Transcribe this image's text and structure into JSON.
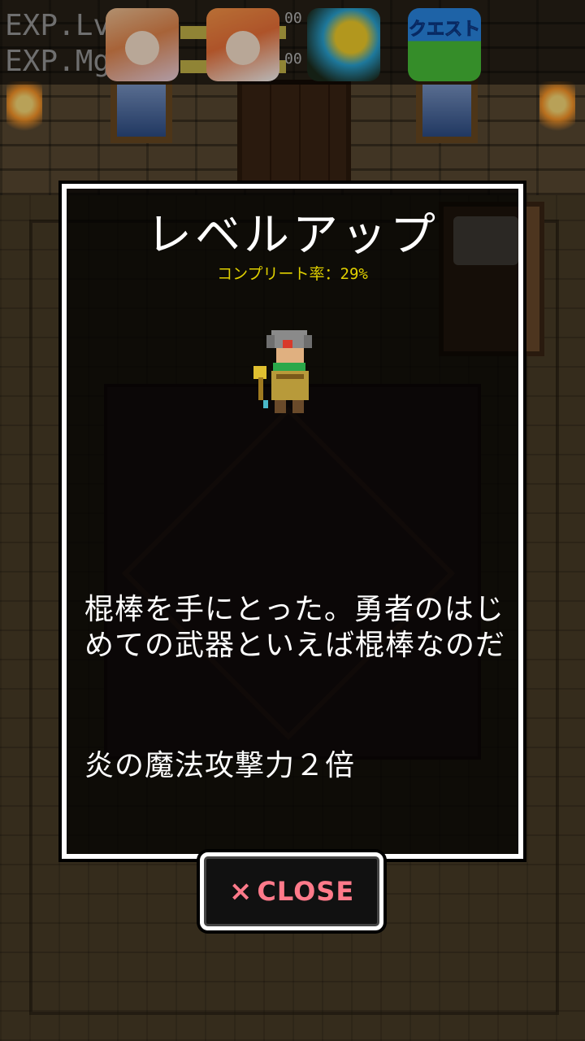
{
  "hud": {
    "exp_lv_label": "EXP.Lv",
    "exp_mg_label": "EXP.Mg",
    "exp_lv_suffix": "00",
    "exp_mg_suffix": "00"
  },
  "ads": {
    "quest_label": "クエスト"
  },
  "dialog": {
    "title": "レベルアップ",
    "completion": "コンプリート率：29%",
    "description": "棍棒を手にとった。勇者のはじめての武器といえば棍棒なのだ",
    "effect": "炎の魔法攻撃力２倍"
  },
  "close_button": {
    "icon": "×",
    "label": "CLOSE"
  },
  "colors": {
    "completion_text": "#e0d000",
    "close_text": "#ff7a8a",
    "dialog_border": "#ffffff"
  }
}
